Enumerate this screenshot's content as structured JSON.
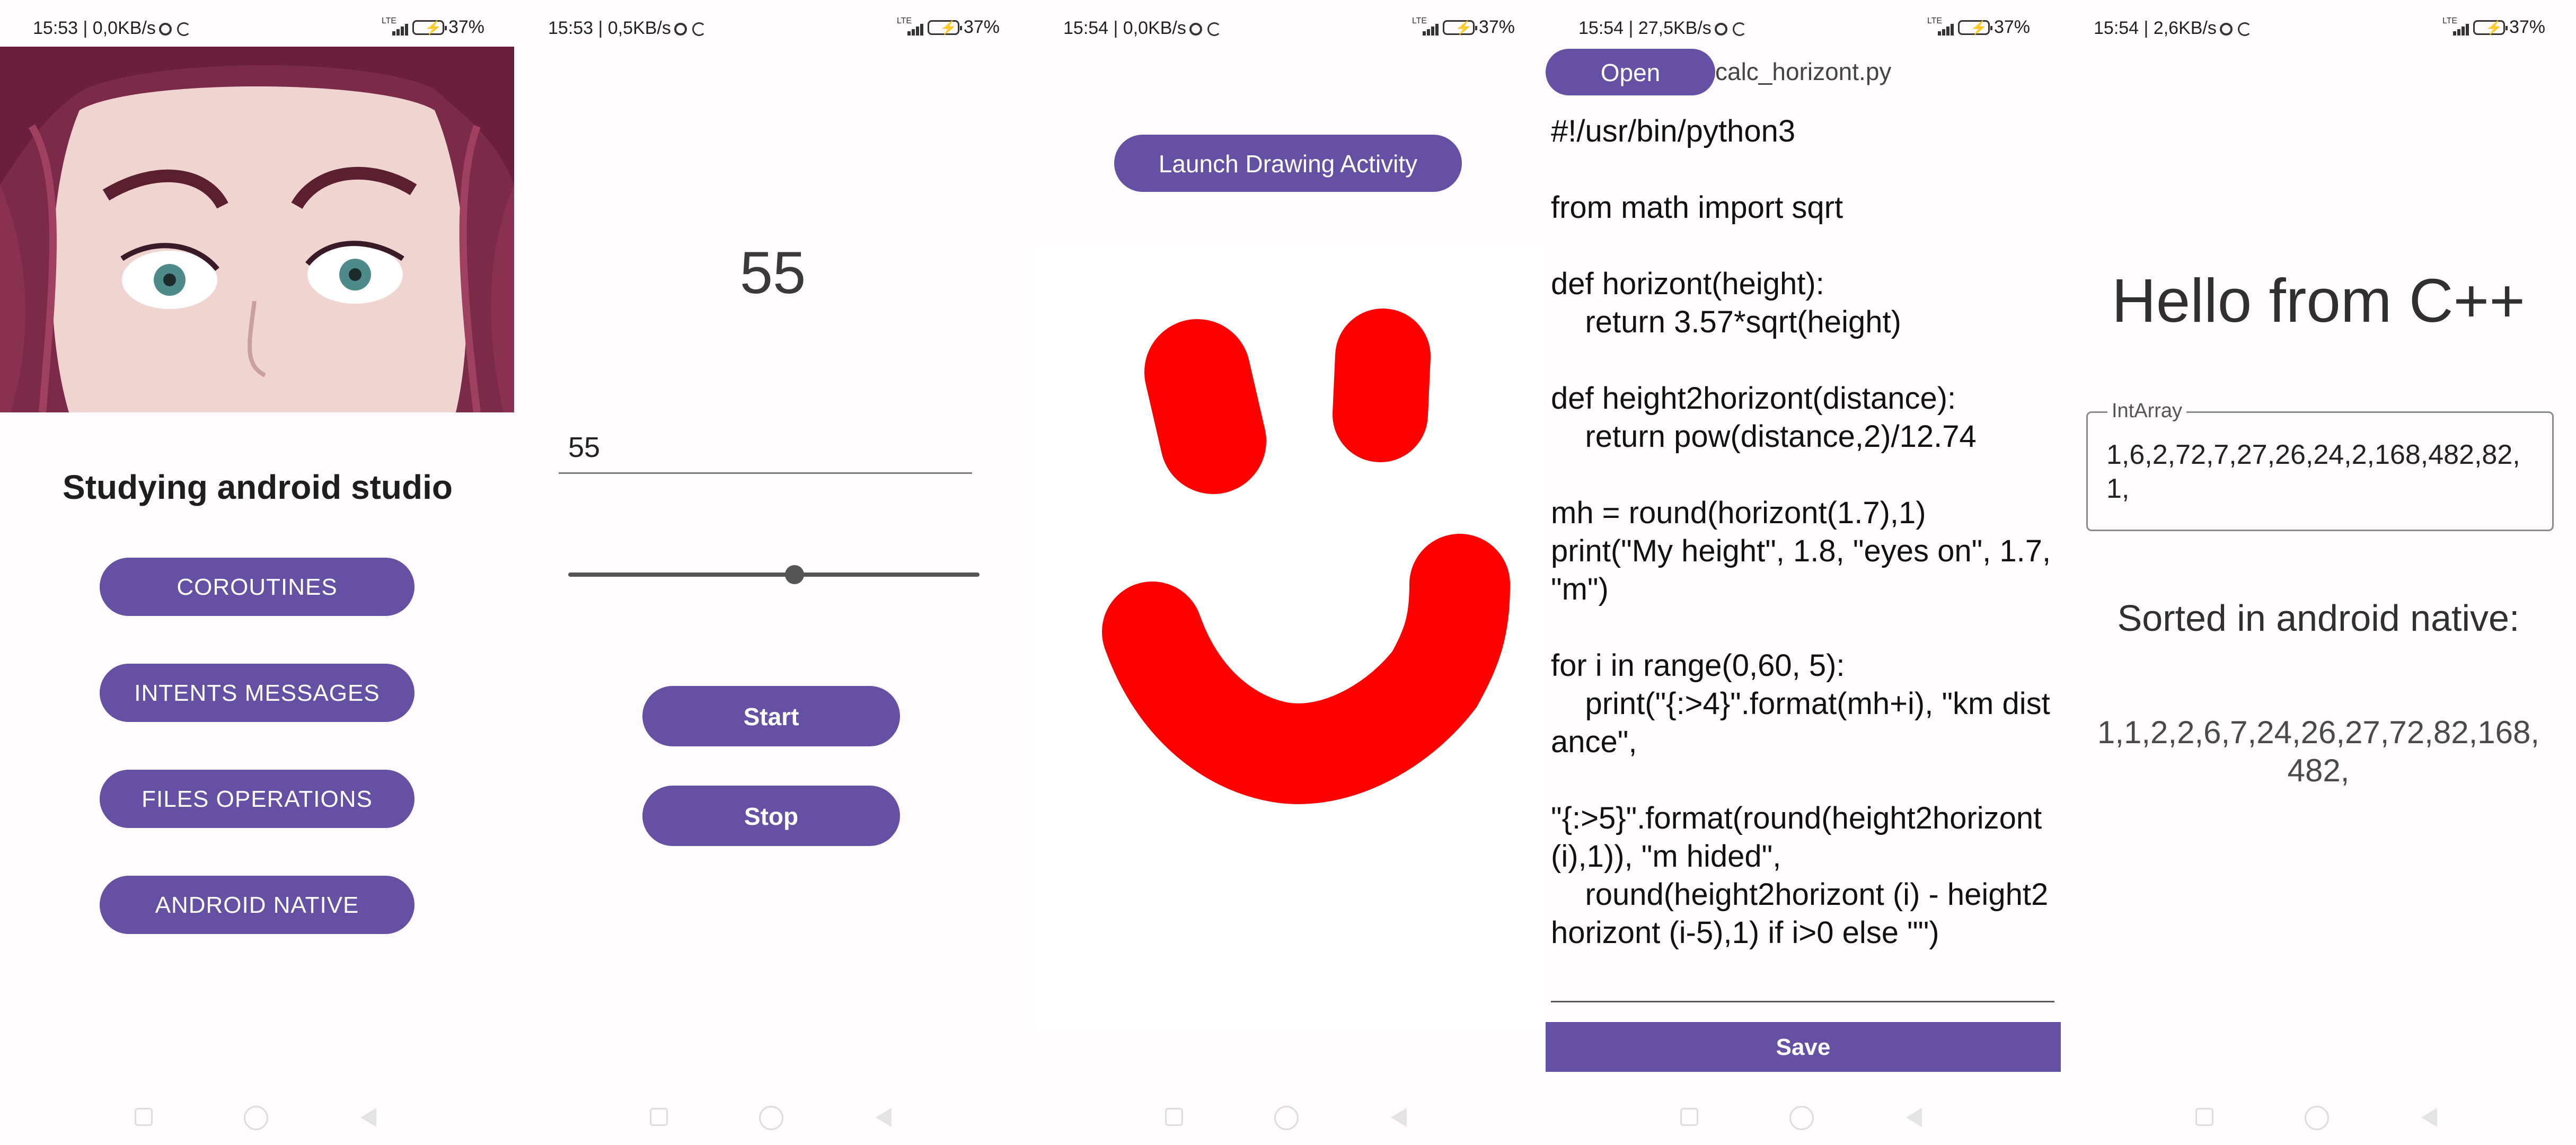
{
  "status_bars": [
    {
      "time_info": "15:53 | 0,0KB/s",
      "battery": "37%",
      "network": "LTE"
    },
    {
      "time_info": "15:53 | 0,5KB/s",
      "battery": "37%",
      "network": "LTE"
    },
    {
      "time_info": "15:54 | 0,0KB/s",
      "battery": "37%",
      "network": "LTE"
    },
    {
      "time_info": "15:54 | 27,5KB/s",
      "battery": "37%",
      "network": "LTE"
    },
    {
      "time_info": "15:54 | 2,6KB/s",
      "battery": "37%",
      "network": "LTE"
    }
  ],
  "main_menu": {
    "title": "Studying android studio",
    "buttons": [
      "COROUTINES",
      "INTENTS MESSAGES",
      "FILES OPERATIONS",
      "ANDROID NATIVE"
    ]
  },
  "coroutines": {
    "counter": "55",
    "input_value": "55",
    "slider_value": 0.55,
    "start_label": "Start",
    "stop_label": "Stop"
  },
  "drawing": {
    "launch_label": "Launch Drawing Activity",
    "stroke_color": "#ff0000"
  },
  "file_editor": {
    "open_label": "Open",
    "file_name": "calc_horizont.py",
    "code": "#!/usr/bin/python3\n\nfrom math import sqrt\n\ndef horizont(height):\n    return 3.57*sqrt(height)\n\ndef height2horizont(distance):\n    return pow(distance,2)/12.74\n\nmh = round(horizont(1.7),1)\nprint(\"My height\", 1.8, \"eyes on\", 1.7, \"m\")\n\nfor i in range(0,60, 5):\n    print(\"{:>4}\".format(mh+i), \"km distance\",\n\n\"{:>5}\".format(round(height2horizont (i),1)), \"m hided\",\n    round(height2horizont (i) - height2horizont (i-5),1) if i>0 else \"\")",
    "save_label": "Save"
  },
  "native": {
    "hello": "Hello from C++",
    "array_label": "IntArray",
    "array_value": "1,6,2,72,7,27,26,24,2,168,482,82,1,",
    "sorted_title": "Sorted in android native:",
    "sorted_value": "1,1,2,2,6,7,24,26,27,72,82,168,482,"
  },
  "colors": {
    "accent": "#6650a4",
    "background": "#fffbfe",
    "drawing_red": "#ff0000"
  }
}
